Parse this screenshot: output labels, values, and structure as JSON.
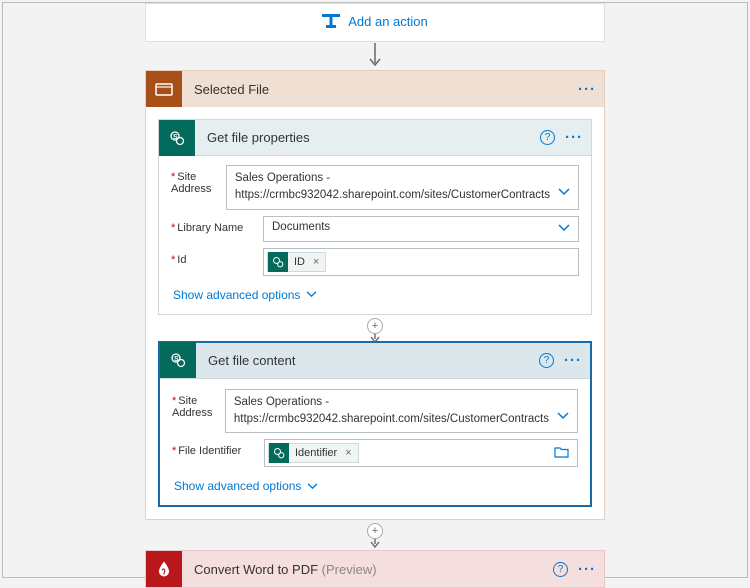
{
  "addAction": {
    "label": "Add an action"
  },
  "scope": {
    "title": "Selected File"
  },
  "getFileProps": {
    "title": "Get file properties",
    "siteAddressLabel": "Site Address",
    "siteAddressLine1": "Sales Operations -",
    "siteAddressLine2": "https://crmbc932042.sharepoint.com/sites/CustomerContracts",
    "libraryLabel": "Library Name",
    "libraryValue": "Documents",
    "idLabel": "Id",
    "idTokenLabel": "ID",
    "advancedLabel": "Show advanced options"
  },
  "getFileContent": {
    "title": "Get file content",
    "siteAddressLabel": "Site Address",
    "siteAddressLine1": "Sales Operations -",
    "siteAddressLine2": "https://crmbc932042.sharepoint.com/sites/CustomerContracts",
    "fileIdLabel": "File Identifier",
    "fileIdTokenLabel": "Identifier",
    "advancedLabel": "Show advanced options"
  },
  "convert": {
    "title": "Convert Word to PDF",
    "preview": "(Preview)"
  }
}
